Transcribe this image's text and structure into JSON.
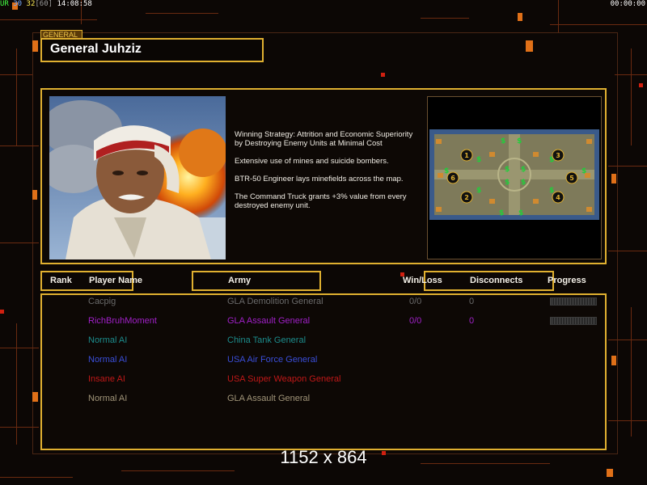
{
  "status_bar": {
    "ur": "UR",
    "fps_a": "30",
    "fps_b": "32",
    "fps_c": "[60]",
    "clock": "14:08:58",
    "timer": "00:00:00"
  },
  "general": {
    "tag": "GENERAL",
    "name": "General Juhziz",
    "description": [
      "Winning Strategy: Attrition and Economic Superiority by Destroying Enemy Units at Minimal Cost",
      "Extensive use of mines and suicide bombers.",
      "BTR-50 Engineer lays minefields across the map.",
      "The Command Truck grants +3% value from every destroyed enemy unit."
    ]
  },
  "minimap": {
    "start_positions": [
      "1",
      "2",
      "3",
      "4",
      "5",
      "6"
    ]
  },
  "table": {
    "headers": {
      "rank": "Rank",
      "player": "Player Name",
      "army": "Army",
      "winloss": "Win/Loss",
      "disconnects": "Disconnects",
      "progress": "Progress"
    },
    "rows": [
      {
        "player": "Cacpig",
        "army": "GLA Demolition General",
        "winloss": "0/0",
        "disconnects": "0",
        "color": "#6a6a6a",
        "has_progress": true
      },
      {
        "player": "RichBruhMoment",
        "army": "GLA Assault General",
        "winloss": "0/0",
        "disconnects": "0",
        "color": "#a020c8",
        "has_progress": true
      },
      {
        "player": "Normal AI",
        "army": "China Tank General",
        "winloss": "",
        "disconnects": "",
        "color": "#1c8c8c",
        "has_progress": false
      },
      {
        "player": "Normal AI",
        "army": "USA Air Force General",
        "winloss": "",
        "disconnects": "",
        "color": "#3a4ed8",
        "has_progress": false
      },
      {
        "player": "Insane AI",
        "army": "USA Super Weapon General",
        "winloss": "",
        "disconnects": "",
        "color": "#c01818",
        "has_progress": false
      },
      {
        "player": "Normal AI",
        "army": "GLA Assault General",
        "winloss": "",
        "disconnects": "",
        "color": "#a09478",
        "has_progress": false
      }
    ]
  },
  "resolution_label": "1152 x 864",
  "colors": {
    "accent": "#e0b030",
    "background": "#0c0705",
    "decor_orange": "#e07018"
  }
}
